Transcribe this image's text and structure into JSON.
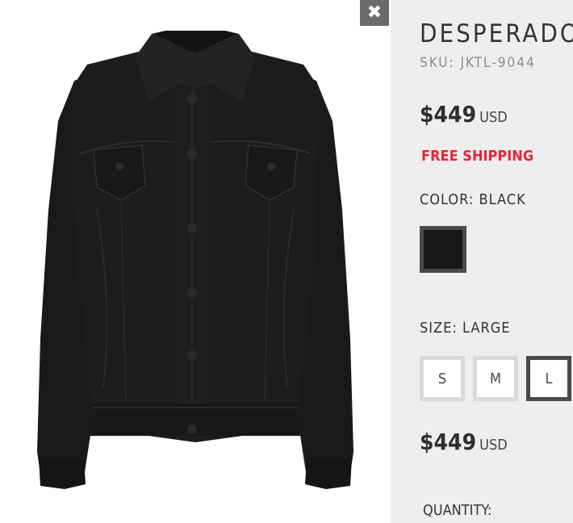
{
  "product": {
    "title": "DESPERADO",
    "sku": "SKU: JKTL-9044",
    "price": "$449",
    "currency": "USD",
    "shipping": "FREE SHIPPING",
    "color_label": "COLOR: BLACK",
    "size_label": "SIZE: LARGE",
    "quantity_label": "QUANTITY:",
    "selected_color": "#181818"
  },
  "sizes": [
    {
      "label": "S",
      "selected": false
    },
    {
      "label": "M",
      "selected": false
    },
    {
      "label": "L",
      "selected": true
    }
  ],
  "colors": {
    "panel_bg": "#eeeeee",
    "accent_red": "#e8253a",
    "selected_border": "#4a4a4a"
  },
  "icons": {
    "close": "close-icon",
    "image": "product-jacket-image"
  },
  "close_glyph": "✖"
}
